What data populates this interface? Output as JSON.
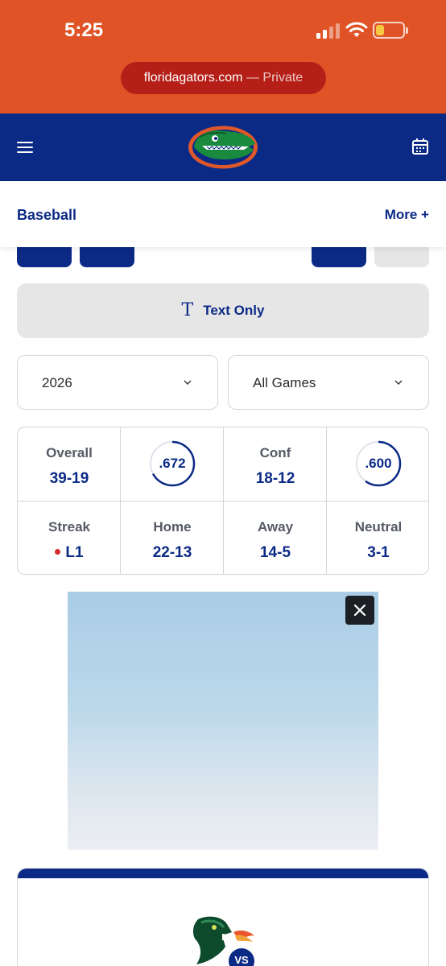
{
  "status_bar": {
    "time": "5:25",
    "signal_icon": "cellular-signal-icon",
    "wifi_icon": "wifi-icon",
    "battery_icon": "battery-low-icon",
    "battery_color": "#f7c843"
  },
  "browser": {
    "url": "floridagators.com",
    "mode": "— Private"
  },
  "header": {
    "menu_icon": "hamburger-menu-icon",
    "logo": "florida-gators-logo",
    "calendar_icon": "calendar-icon"
  },
  "sport_bar": {
    "title": "Baseball",
    "more_label": "More +"
  },
  "view_toggle": {
    "icon": "T",
    "label": "Text Only"
  },
  "filters": {
    "season": "2026",
    "games": "All Games"
  },
  "record": {
    "overall_label": "Overall",
    "overall_value": "39-19",
    "overall_pct": ".672",
    "overall_pct_value": 0.672,
    "conf_label": "Conf",
    "conf_value": "18-12",
    "conf_pct": ".600",
    "conf_pct_value": 0.6,
    "streak_label": "Streak",
    "streak_value": "L1",
    "home_label": "Home",
    "home_value": "22-13",
    "away_label": "Away",
    "away_value": "14-5",
    "neutral_label": "Neutral",
    "neutral_value": "3-1"
  },
  "ad": {
    "close_icon": "close-icon"
  },
  "game_card": {
    "opponent_logo": "dragon-logo",
    "vs_label": "VS"
  },
  "colors": {
    "accent_orange": "#df5327",
    "navy": "#0b2a86",
    "streak_loss": "#d62b2b"
  }
}
